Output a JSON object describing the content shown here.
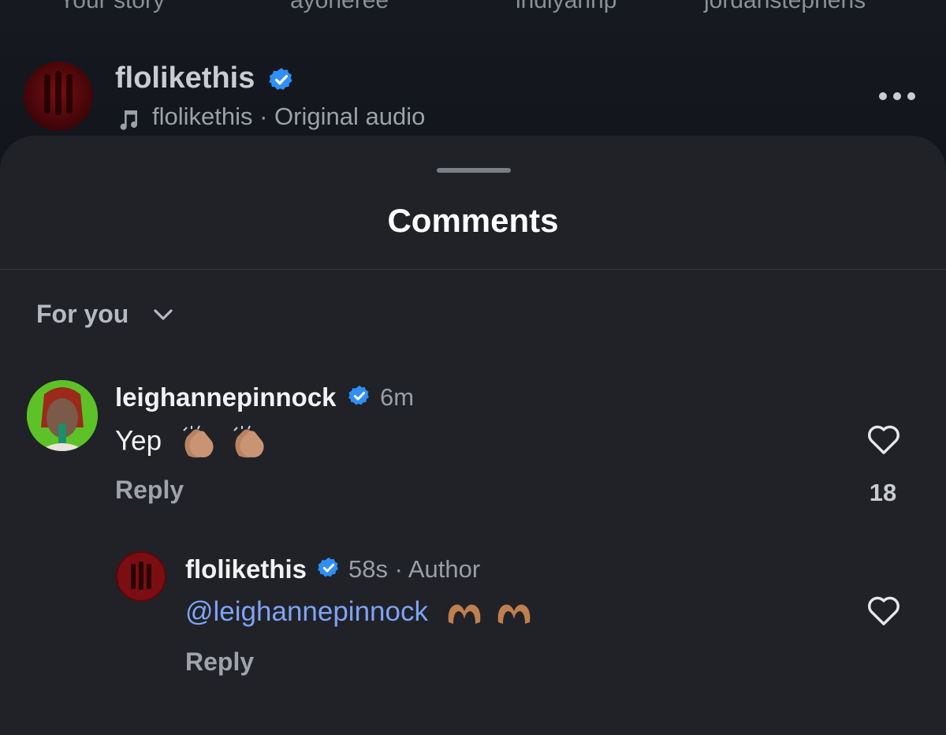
{
  "stories": [
    "Your story",
    "ayoneree",
    "indiyahnp",
    "jordanstephens"
  ],
  "post": {
    "username": "flolikethis",
    "audio": "flolikethis · Original audio"
  },
  "sheet": {
    "title": "Comments",
    "sort_label": "For you"
  },
  "comments": [
    {
      "username": "leighannepinnock",
      "time": "6m",
      "text": "Yep",
      "emoji": "clapping-hands-medium-skin",
      "reply_label": "Reply",
      "likes": "18"
    }
  ],
  "reply": {
    "username": "flolikethis",
    "meta": "58s · Author",
    "mention": "@leighannepinnock",
    "emoji": "heart-hands-medium-skin",
    "reply_label": "Reply"
  },
  "colors": {
    "verified": "#2f8ff5",
    "mention": "#7ea3f5",
    "sheet": "#202227"
  }
}
